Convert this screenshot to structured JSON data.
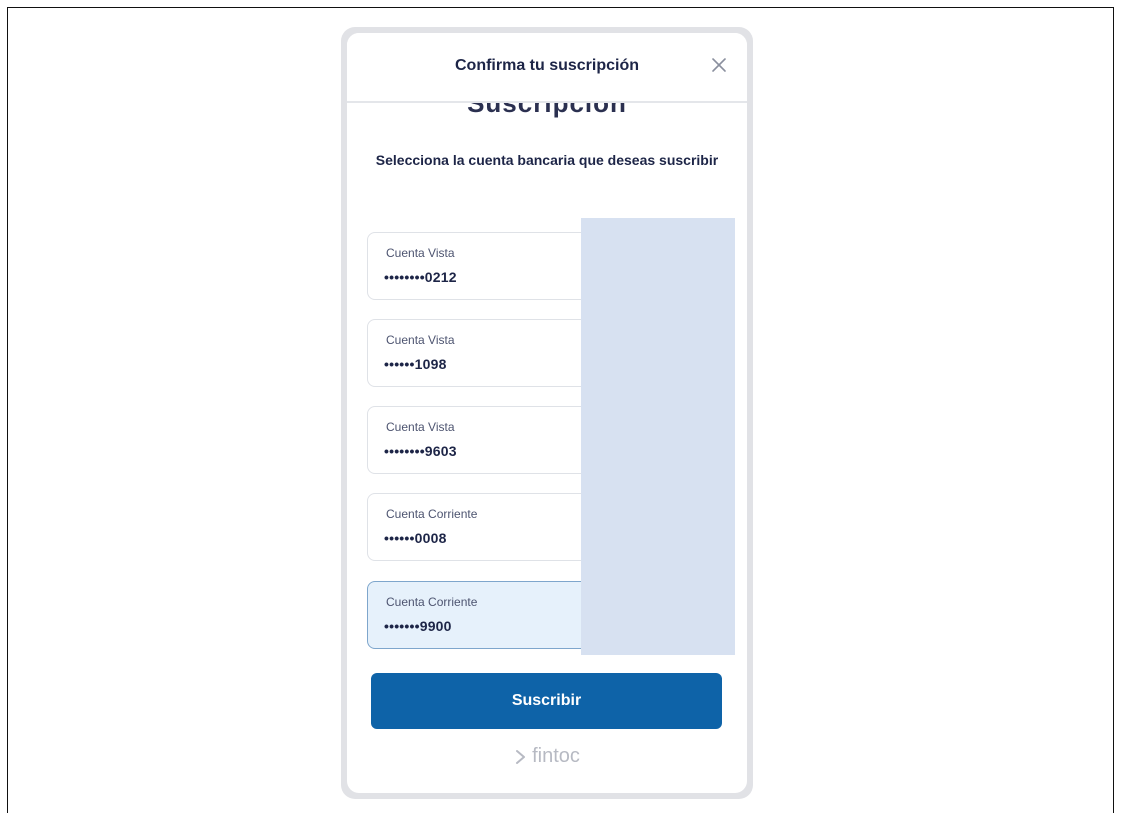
{
  "modal": {
    "title": "Confirma tu suscripción",
    "scrolled_title": "Suscripción",
    "prompt": "Selecciona la cuenta bancaria que deseas suscribir"
  },
  "accounts": [
    {
      "type": "Cuenta Vista",
      "number": "••••••••0212",
      "selected": false
    },
    {
      "type": "Cuenta Vista",
      "number": "••••••1098",
      "selected": false
    },
    {
      "type": "Cuenta Vista",
      "number": "••••••••9603",
      "selected": false
    },
    {
      "type": "Cuenta Corriente",
      "number": "••••••0008",
      "selected": false
    },
    {
      "type": "Cuenta Corriente",
      "number": "•••••••9900",
      "selected": true
    }
  ],
  "actions": {
    "subscribe_label": "Suscribir"
  },
  "footer": {
    "brand": "fintoc"
  },
  "colors": {
    "primary": "#0e63a8",
    "title_text": "#1d2547",
    "selected_bg": "#e6f1fb",
    "redaction": "#d7e1f1"
  },
  "icons": {
    "close": "close-icon",
    "brand_mark": "fintoc-arrow-icon"
  }
}
